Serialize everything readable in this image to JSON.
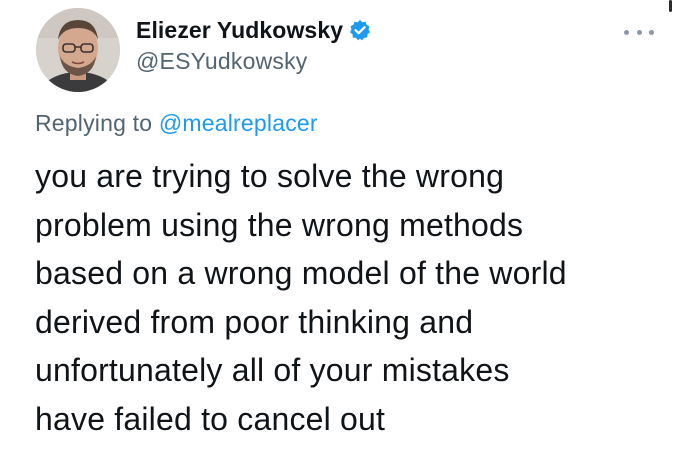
{
  "author": {
    "display_name": "Eliezer Yudkowsky",
    "handle": "@ESYudkowsky",
    "verified_icon": "verified-badge-icon",
    "avatar_icon": "profile-photo"
  },
  "reply": {
    "prefix": "Replying to ",
    "mention": "@mealreplacer"
  },
  "tweet": {
    "lines": [
      "you are trying to solve the wrong",
      "problem using the wrong methods",
      "based on a wrong model of the world",
      "derived from poor thinking and",
      "unfortunately all of your mistakes",
      "have failed to cancel out"
    ]
  },
  "menu": {
    "icon": "more-options-icon"
  },
  "colors": {
    "accent": "#1d9bf0",
    "secondary_text": "#536471",
    "primary_text": "#0f1419"
  }
}
